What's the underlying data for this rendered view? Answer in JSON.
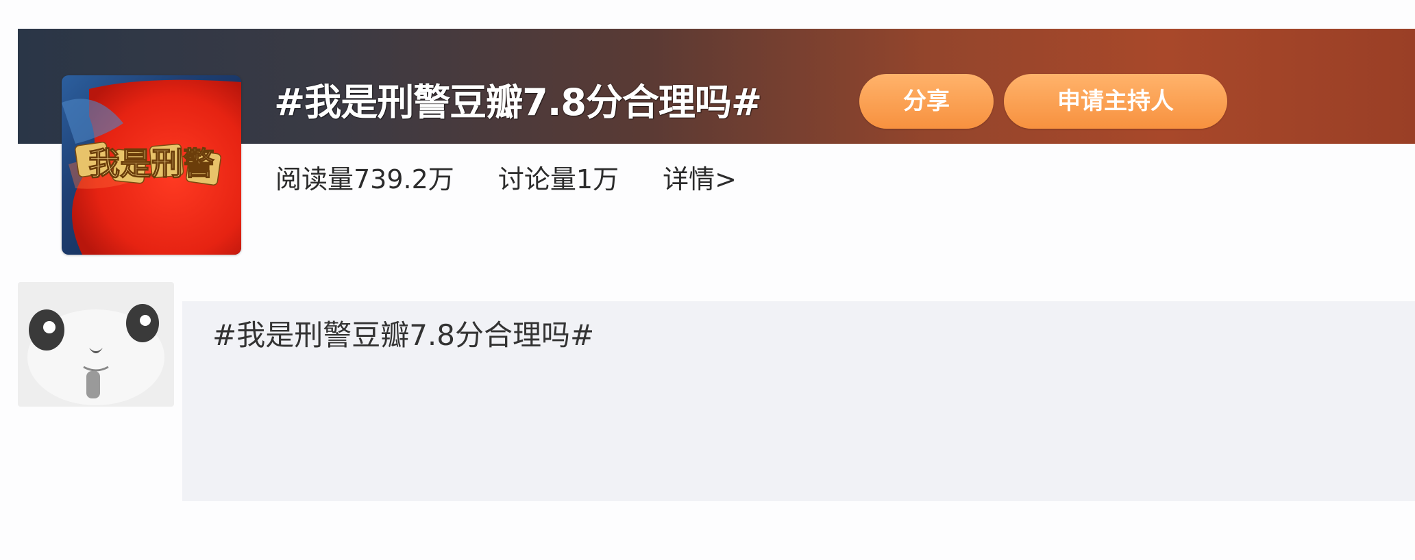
{
  "topic": {
    "title": "#我是刑警豆瓣7.8分合理吗#",
    "cover_text": "我是刑警",
    "stats": {
      "read": "阅读量739.2万",
      "discuss": "讨论量1万",
      "detail": "详情>"
    }
  },
  "actions": {
    "share_label": "分享",
    "apply_host_label": "申请主持人"
  },
  "post": {
    "text": "#我是刑警豆瓣7.8分合理吗#"
  },
  "colors": {
    "banner_left": "#2a3647",
    "banner_right": "#a8482a",
    "button": "#f7913f",
    "post_background": "#f1f2f6"
  }
}
